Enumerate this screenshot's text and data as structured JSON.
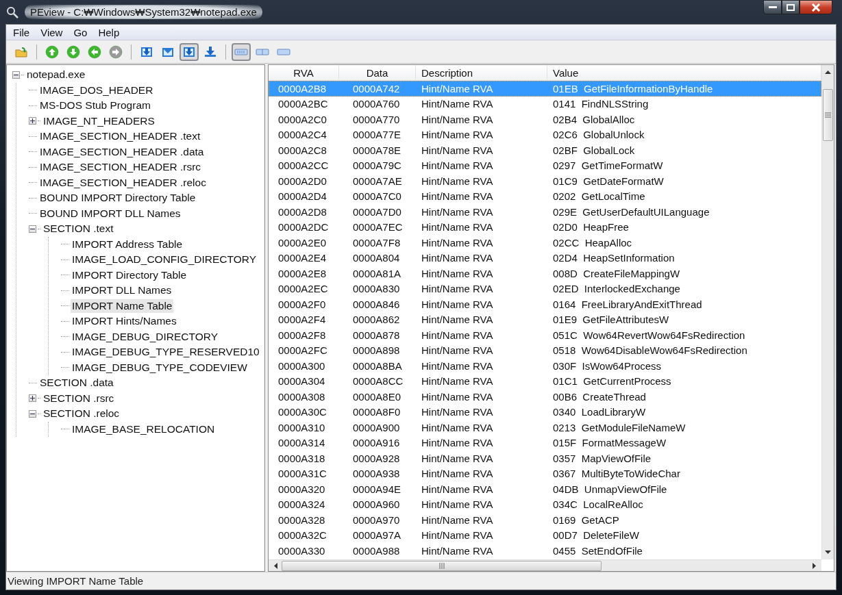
{
  "window": {
    "title": "PEview - C:₩Windows₩System32₩notepad.exe"
  },
  "menu": [
    "File",
    "View",
    "Go",
    "Help"
  ],
  "toolbar": [
    [
      {
        "kind": "open",
        "pressed": false
      }
    ],
    [
      {
        "kind": "up",
        "pressed": false,
        "disabled": false
      },
      {
        "kind": "down",
        "pressed": false,
        "disabled": false
      },
      {
        "kind": "back",
        "pressed": false,
        "disabled": false
      },
      {
        "kind": "forward",
        "pressed": false,
        "disabled": true
      }
    ],
    [
      {
        "kind": "tray-down",
        "pressed": false
      },
      {
        "kind": "tray",
        "pressed": false
      },
      {
        "kind": "tray-down",
        "pressed": true
      },
      {
        "kind": "arrow-down",
        "pressed": false
      }
    ],
    [
      {
        "kind": "view-wide",
        "pressed": true
      },
      {
        "kind": "view-mid",
        "pressed": false
      },
      {
        "kind": "view-narrow",
        "pressed": false
      }
    ]
  ],
  "tree": [
    {
      "label": "notepad.exe",
      "expanded": true,
      "selected": false,
      "children": [
        {
          "label": "IMAGE_DOS_HEADER",
          "selected": false
        },
        {
          "label": "MS-DOS Stub Program",
          "selected": false
        },
        {
          "label": "IMAGE_NT_HEADERS",
          "expanded": false,
          "selected": false
        },
        {
          "label": "IMAGE_SECTION_HEADER .text",
          "selected": false
        },
        {
          "label": "IMAGE_SECTION_HEADER .data",
          "selected": false
        },
        {
          "label": "IMAGE_SECTION_HEADER .rsrc",
          "selected": false
        },
        {
          "label": "IMAGE_SECTION_HEADER .reloc",
          "selected": false
        },
        {
          "label": "BOUND IMPORT Directory Table",
          "selected": false
        },
        {
          "label": "BOUND IMPORT DLL Names",
          "selected": false
        },
        {
          "label": "SECTION .text",
          "expanded": true,
          "selected": false,
          "children": [
            {
              "label": "IMPORT Address Table",
              "selected": false
            },
            {
              "label": "IMAGE_LOAD_CONFIG_DIRECTORY",
              "selected": false
            },
            {
              "label": "IMPORT Directory Table",
              "selected": false
            },
            {
              "label": "IMPORT DLL Names",
              "selected": false
            },
            {
              "label": "IMPORT Name Table",
              "selected": true
            },
            {
              "label": "IMPORT Hints/Names",
              "selected": false
            },
            {
              "label": "IMAGE_DEBUG_DIRECTORY",
              "selected": false
            },
            {
              "label": "IMAGE_DEBUG_TYPE_RESERVED10",
              "selected": false
            },
            {
              "label": "IMAGE_DEBUG_TYPE_CODEVIEW",
              "selected": false
            }
          ]
        },
        {
          "label": "SECTION .data",
          "selected": false
        },
        {
          "label": "SECTION .rsrc",
          "expanded": false,
          "selected": false
        },
        {
          "label": "SECTION .reloc",
          "expanded": true,
          "selected": false,
          "children": [
            {
              "label": "IMAGE_BASE_RELOCATION",
              "selected": false
            }
          ]
        }
      ]
    }
  ],
  "table": {
    "columns": [
      "RVA",
      "Data",
      "Description",
      "Value"
    ],
    "rows": [
      {
        "cells": [
          "0000A2B8",
          "0000A742",
          "Hint/Name RVA",
          "01EB  GetFileInformationByHandle"
        ],
        "selected": true
      },
      {
        "cells": [
          "0000A2BC",
          "0000A760",
          "Hint/Name RVA",
          "0141  FindNLSString"
        ],
        "selected": false
      },
      {
        "cells": [
          "0000A2C0",
          "0000A770",
          "Hint/Name RVA",
          "02B4  GlobalAlloc"
        ],
        "selected": false
      },
      {
        "cells": [
          "0000A2C4",
          "0000A77E",
          "Hint/Name RVA",
          "02C6  GlobalUnlock"
        ],
        "selected": false
      },
      {
        "cells": [
          "0000A2C8",
          "0000A78E",
          "Hint/Name RVA",
          "02BF  GlobalLock"
        ],
        "selected": false
      },
      {
        "cells": [
          "0000A2CC",
          "0000A79C",
          "Hint/Name RVA",
          "0297  GetTimeFormatW"
        ],
        "selected": false
      },
      {
        "cells": [
          "0000A2D0",
          "0000A7AE",
          "Hint/Name RVA",
          "01C9  GetDateFormatW"
        ],
        "selected": false
      },
      {
        "cells": [
          "0000A2D4",
          "0000A7C0",
          "Hint/Name RVA",
          "0202  GetLocalTime"
        ],
        "selected": false
      },
      {
        "cells": [
          "0000A2D8",
          "0000A7D0",
          "Hint/Name RVA",
          "029E  GetUserDefaultUILanguage"
        ],
        "selected": false
      },
      {
        "cells": [
          "0000A2DC",
          "0000A7EC",
          "Hint/Name RVA",
          "02D0  HeapFree"
        ],
        "selected": false
      },
      {
        "cells": [
          "0000A2E0",
          "0000A7F8",
          "Hint/Name RVA",
          "02CC  HeapAlloc"
        ],
        "selected": false
      },
      {
        "cells": [
          "0000A2E4",
          "0000A804",
          "Hint/Name RVA",
          "02D4  HeapSetInformation"
        ],
        "selected": false
      },
      {
        "cells": [
          "0000A2E8",
          "0000A81A",
          "Hint/Name RVA",
          "008D  CreateFileMappingW"
        ],
        "selected": false
      },
      {
        "cells": [
          "0000A2EC",
          "0000A830",
          "Hint/Name RVA",
          "02ED  InterlockedExchange"
        ],
        "selected": false
      },
      {
        "cells": [
          "0000A2F0",
          "0000A846",
          "Hint/Name RVA",
          "0164  FreeLibraryAndExitThread"
        ],
        "selected": false
      },
      {
        "cells": [
          "0000A2F4",
          "0000A862",
          "Hint/Name RVA",
          "01E9  GetFileAttributesW"
        ],
        "selected": false
      },
      {
        "cells": [
          "0000A2F8",
          "0000A878",
          "Hint/Name RVA",
          "051C  Wow64RevertWow64FsRedirection"
        ],
        "selected": false
      },
      {
        "cells": [
          "0000A2FC",
          "0000A898",
          "Hint/Name RVA",
          "0518  Wow64DisableWow64FsRedirection"
        ],
        "selected": false
      },
      {
        "cells": [
          "0000A300",
          "0000A8BA",
          "Hint/Name RVA",
          "030F  IsWow64Process"
        ],
        "selected": false
      },
      {
        "cells": [
          "0000A304",
          "0000A8CC",
          "Hint/Name RVA",
          "01C1  GetCurrentProcess"
        ],
        "selected": false
      },
      {
        "cells": [
          "0000A308",
          "0000A8E0",
          "Hint/Name RVA",
          "00B6  CreateThread"
        ],
        "selected": false
      },
      {
        "cells": [
          "0000A30C",
          "0000A8F0",
          "Hint/Name RVA",
          "0340  LoadLibraryW"
        ],
        "selected": false
      },
      {
        "cells": [
          "0000A310",
          "0000A900",
          "Hint/Name RVA",
          "0213  GetModuleFileNameW"
        ],
        "selected": false
      },
      {
        "cells": [
          "0000A314",
          "0000A916",
          "Hint/Name RVA",
          "015F  FormatMessageW"
        ],
        "selected": false
      },
      {
        "cells": [
          "0000A318",
          "0000A928",
          "Hint/Name RVA",
          "0357  MapViewOfFile"
        ],
        "selected": false
      },
      {
        "cells": [
          "0000A31C",
          "0000A938",
          "Hint/Name RVA",
          "0367  MultiByteToWideChar"
        ],
        "selected": false
      },
      {
        "cells": [
          "0000A320",
          "0000A94E",
          "Hint/Name RVA",
          "04DB  UnmapViewOfFile"
        ],
        "selected": false
      },
      {
        "cells": [
          "0000A324",
          "0000A960",
          "Hint/Name RVA",
          "034C  LocalReAlloc"
        ],
        "selected": false
      },
      {
        "cells": [
          "0000A328",
          "0000A970",
          "Hint/Name RVA",
          "0169  GetACP"
        ],
        "selected": false
      },
      {
        "cells": [
          "0000A32C",
          "0000A97A",
          "Hint/Name RVA",
          "00D7  DeleteFileW"
        ],
        "selected": false
      },
      {
        "cells": [
          "0000A330",
          "0000A988",
          "Hint/Name RVA",
          "0455  SetEndOfFile"
        ],
        "selected": false
      }
    ]
  },
  "status_bar": "Viewing IMPORT Name Table"
}
